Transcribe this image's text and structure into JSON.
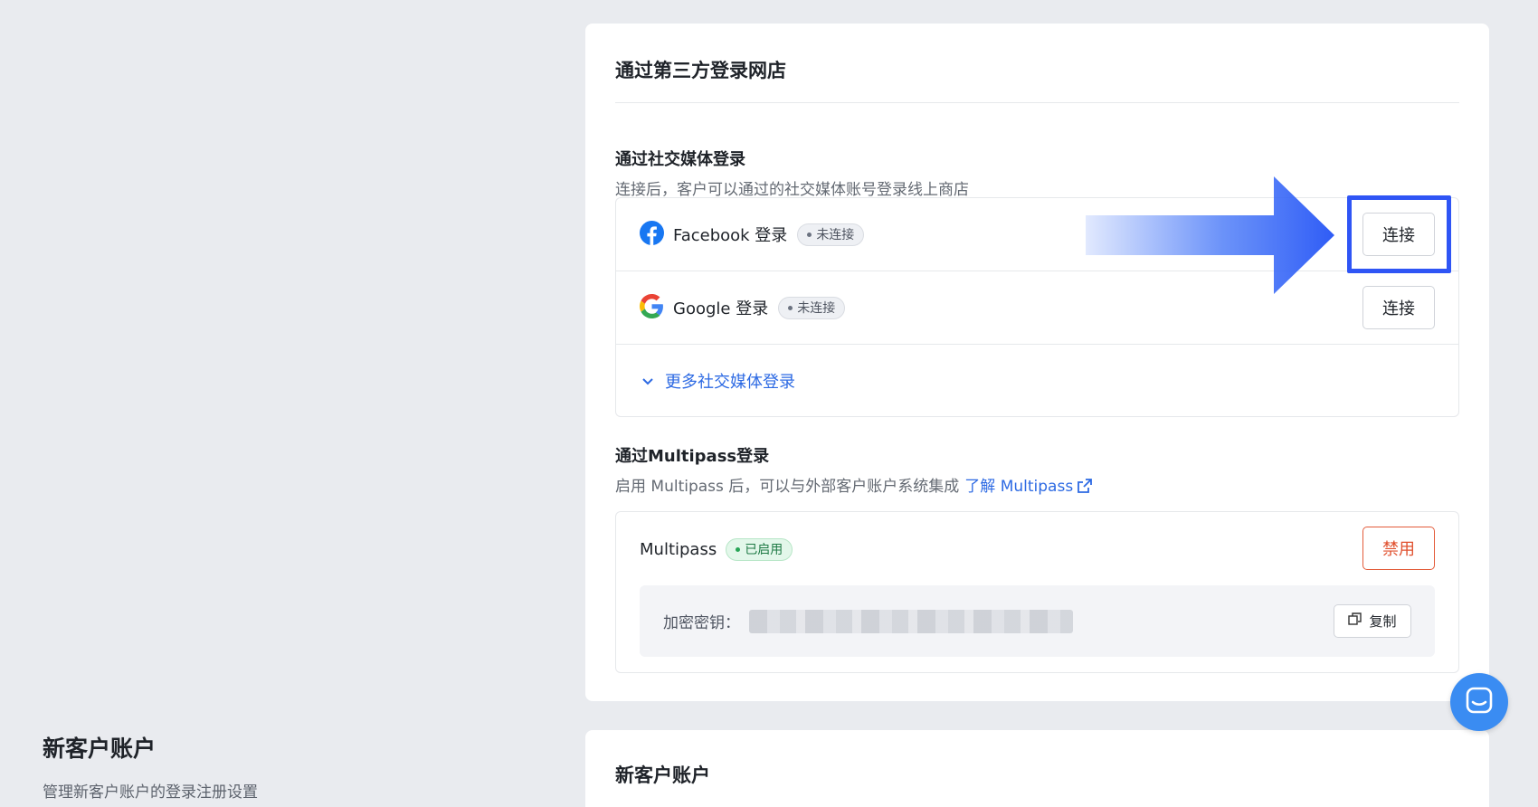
{
  "left_section": {
    "title": "新客户账户",
    "description": "管理新客户账户的登录注册设置"
  },
  "main_card": {
    "title": "通过第三方登录网店",
    "social": {
      "title": "通过社交媒体登录",
      "description": "连接后，客户可以通过的社交媒体账号登录线上商店",
      "providers": [
        {
          "icon": "facebook-icon",
          "label": "Facebook 登录",
          "status": "未连接",
          "action": "连接"
        },
        {
          "icon": "google-icon",
          "label": "Google 登录",
          "status": "未连接",
          "action": "连接"
        }
      ],
      "more_label": "更多社交媒体登录"
    },
    "multipass": {
      "title": "通过Multipass登录",
      "description": "启用 Multipass 后，可以与外部客户账户系统集成",
      "learn_link": "了解 Multipass",
      "name": "Multipass",
      "status": "已启用",
      "disable_label": "禁用",
      "key_label": "加密密钥：",
      "copy_label": "复制"
    }
  },
  "second_card": {
    "title": "新客户账户"
  },
  "colors": {
    "accent": "#2d6ae3",
    "danger": "#e0502e",
    "highlight": "#2f55f5",
    "facebook": "#1877f2",
    "chat": "#3a8cf2"
  }
}
